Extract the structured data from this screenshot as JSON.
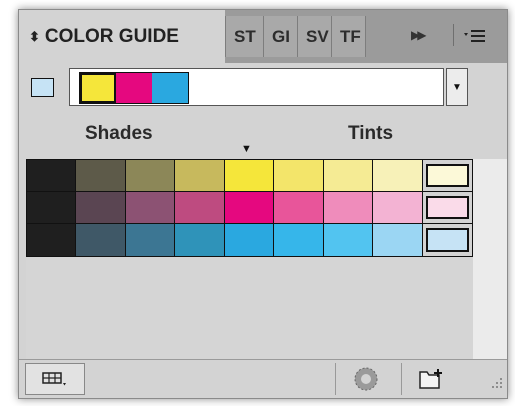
{
  "panel": {
    "active_tab": "COLOR GUIDE",
    "active_tab_arrows": "⬍",
    "other_tabs": [
      "ST",
      "GI",
      "SV",
      "TF"
    ],
    "more_icon": "double-chevron-right-icon",
    "menu_icon": "panel-menu-icon"
  },
  "base_color": "#c6e3f5",
  "harmony": {
    "swatches": [
      "#f5e63a",
      "#e5087f",
      "#2aa8e0"
    ]
  },
  "labels": {
    "shades": "Shades",
    "tints": "Tints"
  },
  "grid": {
    "rows": [
      [
        "#1f1f1f",
        "#5d5a49",
        "#8c8758",
        "#c7b95d",
        "#f5e63a",
        "#f3e56a",
        "#f5eb94",
        "#f7f1b8",
        "#fcf9d8"
      ],
      [
        "#1f1f1f",
        "#5a4552",
        "#8c5273",
        "#be4b80",
        "#e5087f",
        "#e8559a",
        "#ef8cbb",
        "#f3b3d3",
        "#fadbe9"
      ],
      [
        "#1f1f1f",
        "#3f5867",
        "#3c7693",
        "#2f93b9",
        "#2aa8e0",
        "#36b6ea",
        "#52c4f0",
        "#9bd6f3",
        "#c6e3f5"
      ]
    ]
  },
  "colors": {
    "panel_bg": "#d3d3d3",
    "tab_bar_bg": "#9b9b9b",
    "grid_border": "#111111"
  }
}
